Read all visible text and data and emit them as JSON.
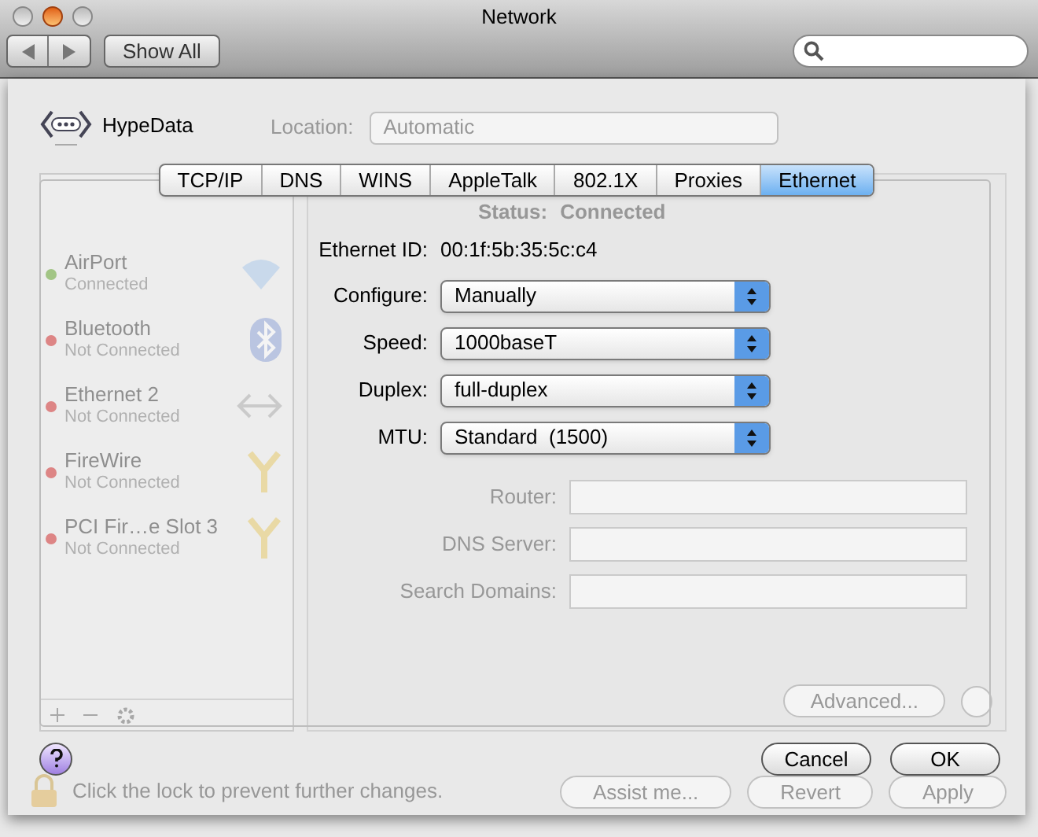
{
  "window": {
    "title": "Network"
  },
  "toolbar": {
    "show_all": "Show All"
  },
  "background": {
    "location": {
      "label": "Location:",
      "value": "Automatic"
    },
    "services": [
      {
        "name": "AirPort",
        "status": "Connected",
        "connected": true,
        "kind": "wifi"
      },
      {
        "name": "Bluetooth",
        "status": "Not Connected",
        "connected": false,
        "kind": "bluetooth"
      },
      {
        "name": "Ethernet 2",
        "status": "Not Connected",
        "connected": false,
        "kind": "ethernet"
      },
      {
        "name": "FireWire",
        "status": "Not Connected",
        "connected": false,
        "kind": "firewire"
      },
      {
        "name": "PCI Fir…e Slot 3",
        "status": "Not Connected",
        "connected": false,
        "kind": "firewire"
      }
    ],
    "status": {
      "label": "Status:",
      "value": "Connected"
    },
    "fields": [
      {
        "label": "Router:"
      },
      {
        "label": "DNS Server:"
      },
      {
        "label": "Search Domains:"
      }
    ],
    "advanced_button": "Advanced...",
    "lock_text": "Click the lock to prevent further changes.",
    "buttons": [
      "Assist me...",
      "Revert",
      "Apply"
    ]
  },
  "sheet": {
    "service_name": "HypeData",
    "tabs": [
      {
        "label": "TCP/IP",
        "selected": false
      },
      {
        "label": "DNS",
        "selected": false
      },
      {
        "label": "WINS",
        "selected": false
      },
      {
        "label": "AppleTalk",
        "selected": false
      },
      {
        "label": "802.1X",
        "selected": false
      },
      {
        "label": "Proxies",
        "selected": false
      },
      {
        "label": "Ethernet",
        "selected": true
      }
    ],
    "ethernet_id": {
      "label": "Ethernet ID:",
      "value": "00:1f:5b:35:5c:c4"
    },
    "popups": [
      {
        "label": "Configure:",
        "value": "Manually"
      },
      {
        "label": "Speed:",
        "value": "1000baseT"
      },
      {
        "label": "Duplex:",
        "value": "full-duplex"
      },
      {
        "label": "MTU:",
        "value": "Standard  (1500)"
      }
    ],
    "buttons": [
      "Cancel",
      "OK"
    ]
  }
}
